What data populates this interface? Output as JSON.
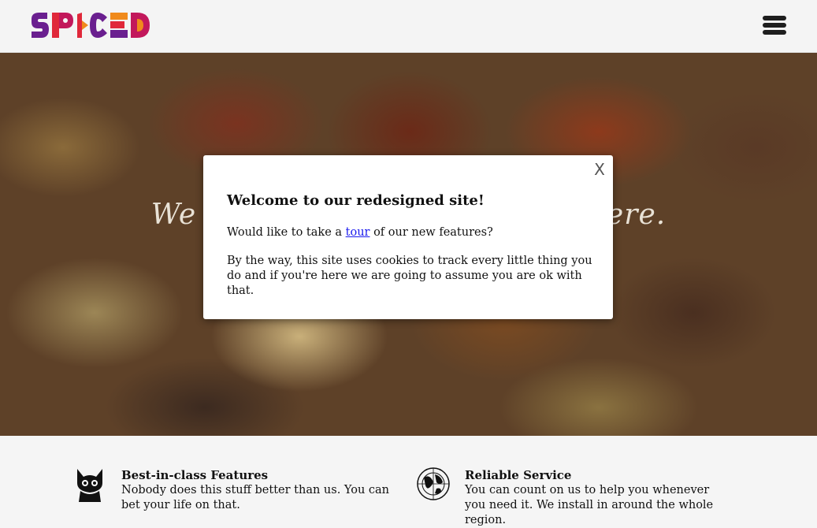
{
  "header": {
    "logo_text": "SPICED",
    "menu_icon": "hamburger-menu-icon"
  },
  "hero": {
    "tagline": "We are the spice of your life here."
  },
  "modal": {
    "close_label": "X",
    "title": "Welcome to our redesigned site!",
    "tour_prefix": "Would like to take a ",
    "tour_link": "tour",
    "tour_suffix": " of our new features?",
    "cookie_text": "By the way, this site uses cookies to track every little thing you do and if you're here we are going to assume you are ok with that."
  },
  "features": [
    {
      "icon": "cat-icon",
      "title": "Best-in-class Features",
      "description": "Nobody does this stuff better than us. You can bet your life on that."
    },
    {
      "icon": "globe-icon",
      "title": "Reliable Service",
      "description": "You can count on us to help you whenever you need it. We install in around the whole region."
    }
  ],
  "colors": {
    "logo_purple": "#6a1f8f",
    "logo_red": "#e0283a",
    "logo_orange": "#f08a1c",
    "link_blue": "#1a1aee"
  }
}
